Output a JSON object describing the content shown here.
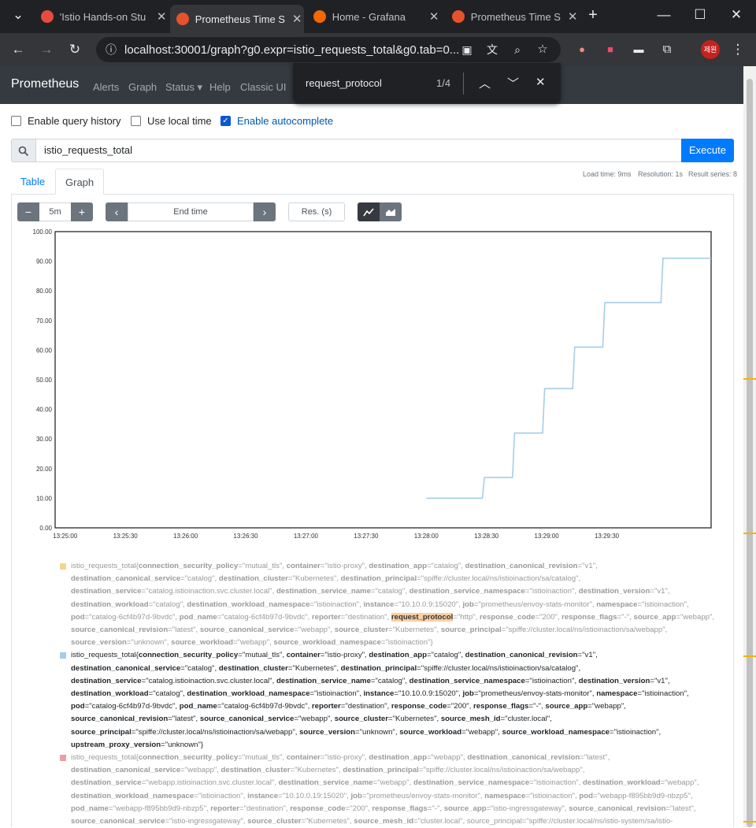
{
  "browser": {
    "tabs": [
      {
        "title": "'Istio Hands-on Stu",
        "favicon_color": "#e94b3c",
        "active": false
      },
      {
        "title": "Prometheus Time S",
        "favicon_color": "#e6522c",
        "active": true
      },
      {
        "title": "Home - Grafana",
        "favicon_color": "#f46800",
        "active": false
      },
      {
        "title": "Prometheus Time S",
        "favicon_color": "#e6522c",
        "active": false
      }
    ],
    "url": "localhost:30001/graph?g0.expr=istio_requests_total&g0.tab=0...",
    "profile_label": "제원"
  },
  "findbar": {
    "query": "request_protocol",
    "count": "1/4"
  },
  "nav": {
    "brand": "Prometheus",
    "items": [
      "Alerts",
      "Graph",
      "Status ▾",
      "Help",
      "Classic UI"
    ]
  },
  "options": {
    "query_history": "Enable query history",
    "local_time": "Use local time",
    "autocomplete": "Enable autocomplete"
  },
  "query": {
    "expr": "istio_requests_total",
    "execute": "Execute"
  },
  "stats": {
    "load": "Load time: 9ms",
    "resolution": "Resolution: 1s",
    "series": "Result series: 8"
  },
  "tabs": {
    "table": "Table",
    "graph": "Graph"
  },
  "controls": {
    "range": "5m",
    "end_time": "End time",
    "res": "Res. (s)"
  },
  "chart_data": {
    "type": "line",
    "x_ticks": [
      "13:25:00",
      "13:25:30",
      "13:26:00",
      "13:26:30",
      "13:27:00",
      "13:27:30",
      "13:28:00",
      "13:28:30",
      "13:29:00",
      "13:29:30"
    ],
    "y_ticks": [
      "0.00",
      "10.00",
      "20.00",
      "30.00",
      "40.00",
      "50.00",
      "60.00",
      "70.00",
      "80.00",
      "90.00",
      "100.00"
    ],
    "ylim": [
      0,
      100
    ],
    "xlim_seconds": [
      -5,
      322
    ],
    "series": [
      {
        "color": "#a6cde8",
        "points_t": [
          180,
          208,
          209,
          223,
          224,
          238,
          239,
          253,
          254,
          268,
          269,
          282,
          283,
          297,
          298,
          310,
          311,
          322
        ],
        "points_y": [
          10,
          10,
          17,
          17,
          32,
          32,
          47,
          47,
          61,
          61,
          76,
          76,
          76,
          76,
          91,
          91,
          91,
          91
        ]
      }
    ],
    "grid": true
  },
  "legend": {
    "series": [
      {
        "color": "#f4d58d",
        "dim": true,
        "text": "istio_requests_total{connection_security_policy=\"mutual_tls\", container=\"istio-proxy\", destination_app=\"catalog\", destination_canonical_revision=\"v1\", destination_canonical_service=\"catalog\", destination_cluster=\"Kubernetes\", destination_principal=\"spiffe://cluster.local/ns/istioinaction/sa/catalog\", destination_service=\"catalog.istioinaction.svc.cluster.local\", destination_service_name=\"catalog\", destination_service_namespace=\"istioinaction\", destination_version=\"v1\", destination_workload=\"catalog\", destination_workload_namespace=\"istioinaction\", instance=\"10.10.0.9:15020\", job=\"prometheus/envoy-stats-monitor\", namespace=\"istioinaction\", pod=\"catalog-6cf4b97d-9bvdc\", pod_name=\"catalog-6cf4b97d-9bvdc\", reporter=\"destination\", ",
        "highlight": "request_protocol",
        "text_after": "=\"http\", response_code=\"200\", response_flags=\"-\", source_app=\"webapp\", source_canonical_revision=\"latest\", source_canonical_service=\"webapp\", source_cluster=\"Kubernetes\", source_principal=\"spiffe://cluster.local/ns/istioinaction/sa/webapp\", source_version=\"unknown\", source_workload=\"webapp\", source_workload_namespace=\"istioinaction\"}"
      },
      {
        "color": "#a6cde8",
        "dim": false,
        "text": "istio_requests_total{connection_security_policy=\"mutual_tls\", container=\"istio-proxy\", destination_app=\"catalog\", destination_canonical_revision=\"v1\", destination_canonical_service=\"catalog\", destination_cluster=\"Kubernetes\", destination_principal=\"spiffe://cluster.local/ns/istioinaction/sa/catalog\", destination_service=\"catalog.istioinaction.svc.cluster.local\", destination_service_name=\"catalog\", destination_service_namespace=\"istioinaction\", destination_version=\"v1\", destination_workload=\"catalog\", destination_workload_namespace=\"istioinaction\", instance=\"10.10.0.9:15020\", job=\"prometheus/envoy-stats-monitor\", namespace=\"istioinaction\", pod=\"catalog-6cf4b97d-9bvdc\", pod_name=\"catalog-6cf4b97d-9bvdc\", reporter=\"destination\", response_code=\"200\", response_flags=\"-\", source_app=\"webapp\", source_canonical_revision=\"latest\", source_canonical_service=\"webapp\", source_cluster=\"Kubernetes\", source_mesh_id=\"cluster.local\", source_principal=\"spiffe://cluster.local/ns/istioinaction/sa/webapp\", source_version=\"unknown\", source_workload=\"webapp\", source_workload_namespace=\"istioinaction\", upstream_proxy_version=\"unknown\"}"
      },
      {
        "color": "#e8a0a8",
        "dim": true,
        "text": "istio_requests_total{connection_security_policy=\"mutual_tls\", container=\"istio-proxy\", destination_app=\"webapp\", destination_canonical_revision=\"latest\", destination_canonical_service=\"webapp\", destination_cluster=\"Kubernetes\", destination_principal=\"spiffe://cluster.local/ns/istioinaction/sa/webapp\", destination_service=\"webapp.istioinaction.svc.cluster.local\", destination_service_name=\"webapp\", destination_service_namespace=\"istioinaction\", destination_workload=\"webapp\", destination_workload_namespace=\"istioinaction\", instance=\"10.10.0.19:15020\", job=\"prometheus/envoy-stats-monitor\", namespace=\"istioinaction\", pod=\"webapp-f895bb9d9-nbzp5\", pod_name=\"webapp-f895bb9d9-nbzp5\", reporter=\"destination\", response_code=\"200\", response_flags=\"-\", source_app=\"istio-ingressgateway\", source_canonical_revision=\"latest\", source_canonical_service=\"istio-ingressgateway\", source_cluster=\"Kubernetes\", source_mesh_id=\"cluster.local\", source_principal=\"spiffe://cluster.local/ns/istio-system/sa/istio-"
      }
    ]
  }
}
